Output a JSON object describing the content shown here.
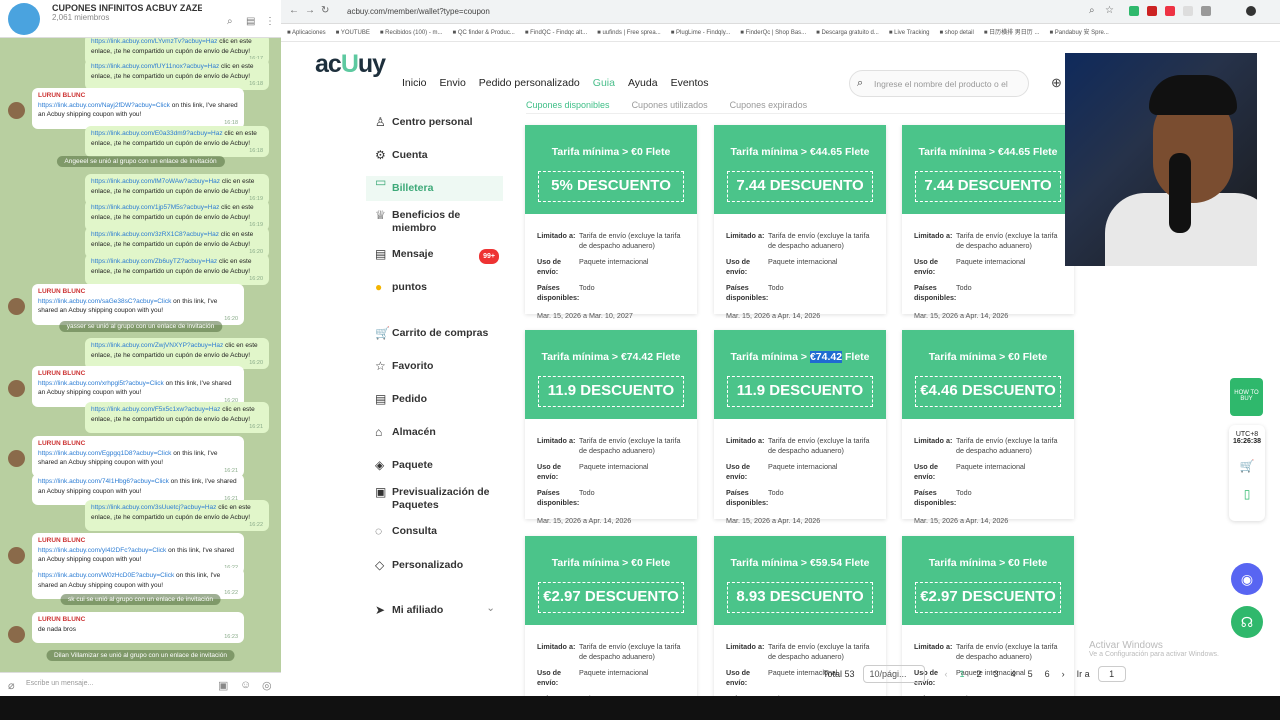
{
  "telegram": {
    "title": "CUPONES INFINITOS ACBUY ZAZERR",
    "members": "2,061 miembros",
    "input_placeholder": "Escribe un mensaje...",
    "messages": [
      {
        "type": "out",
        "link": "https://link.acbuy.com/LYvmzTv?acbuy=Haz",
        "text": " clic en este enlace, ¡te he compartido un cupón de envío de Acbuy!",
        "time": "16:17"
      },
      {
        "type": "out",
        "link": "https://link.acbuy.com/fUY11nox?acbuy=Haz",
        "text": " clic en este enlace, ¡te he compartido un cupón de envío de Acbuy!",
        "time": "16:18"
      },
      {
        "type": "in",
        "who": "LURUN BLUNC",
        "link": "https://link.acbuy.com/Nayj2fDW?acbuy=Click",
        "text": " on this link, I've shared an Acbuy shipping coupon with you!",
        "time": "16:18"
      },
      {
        "type": "out",
        "link": "https://link.acbuy.com/E0a33dm9?acbuy=Haz",
        "text": " clic en este enlace, ¡te he compartido un cupón de envío de Acbuy!",
        "time": "16:18"
      },
      {
        "type": "sys",
        "text": "Angeeel se unió al grupo con un enlace de invitación"
      },
      {
        "type": "out",
        "link": "https://link.acbuy.com/lM7oWAw?acbuy=Haz",
        "text": " clic en este enlace, ¡te he compartido un cupón de envío de Acbuy!",
        "time": "16:19"
      },
      {
        "type": "out",
        "link": "https://link.acbuy.com/1jp57M5s?acbuy=Haz",
        "text": " clic en este enlace, ¡te he compartido un cupón de envío de Acbuy!",
        "time": "16:19"
      },
      {
        "type": "out",
        "link": "https://link.acbuy.com/3zRX1C8?acbuy=Haz",
        "text": " clic en este enlace, ¡te he compartido un cupón de envío de Acbuy!",
        "time": "16:20"
      },
      {
        "type": "out",
        "link": "https://link.acbuy.com/Zb6uyTZ?acbuy=Haz",
        "text": " clic en este enlace, ¡te he compartido un cupón de envío de Acbuy!",
        "time": "16:20"
      },
      {
        "type": "in",
        "who": "LURUN BLUNC",
        "link": "https://link.acbuy.com/saGe38sC?acbuy=Click",
        "text": " on this link, I've shared an Acbuy shipping coupon with you!",
        "time": "16:20"
      },
      {
        "type": "sys",
        "text": "yasser se unió al grupo con un enlace de invitación"
      },
      {
        "type": "out",
        "link": "https://link.acbuy.com/ZwjVNXYP?acbuy=Haz",
        "text": " clic en este enlace, ¡te he compartido un cupón de envío de Acbuy!",
        "time": "16:20"
      },
      {
        "type": "in",
        "who": "LURUN BLUNC",
        "link": "https://link.acbuy.com/xrhpgl5t?acbuy=Click",
        "text": " on this link, I've shared an Acbuy shipping coupon with you!",
        "time": "16:20"
      },
      {
        "type": "out",
        "link": "https://link.acbuy.com/F5x5c1xw?acbuy=Haz",
        "text": " clic en este enlace, ¡te he compartido un cupón de envío de Acbuy!",
        "time": "16:21"
      },
      {
        "type": "in",
        "who": "LURUN BLUNC",
        "link": "https://link.acbuy.com/Egpgq1D8?acbuy=Click",
        "text": " on this link, I've shared an Acbuy shipping coupon with you!",
        "time": "16:21"
      },
      {
        "type": "in2",
        "link": "https://link.acbuy.com/74I1Hbg6?acbuy=Click",
        "text": " on this link, I've shared an Acbuy shipping coupon with you!",
        "time": "16:21"
      },
      {
        "type": "out",
        "link": "https://link.acbuy.com/3sUuetcj?acbuy=Haz",
        "text": " clic en este enlace, ¡te he compartido un cupón de envío de Acbuy!",
        "time": "16:22"
      },
      {
        "type": "in",
        "who": "LURUN BLUNC",
        "link": "https://link.acbuy.com/yI4l2DFc?acbuy=Click",
        "text": " on this link, I've shared an Acbuy shipping coupon with you!",
        "time": "16:22"
      },
      {
        "type": "in2",
        "link": "https://link.acbuy.com/W0zHcD0E?acbuy=Click",
        "text": " on this link, I've shared an Acbuy shipping coupon with you!",
        "time": "16:22"
      },
      {
        "type": "sys",
        "text": "sk cui se unió al grupo con un enlace de invitación"
      },
      {
        "type": "in",
        "who": "LURUN BLUNC",
        "link": "",
        "text": "de nada bros",
        "time": "16:23"
      },
      {
        "type": "sys",
        "text": "Dilan Villamizar se unió al grupo con un enlace de invitación"
      }
    ]
  },
  "browser": {
    "url": "acbuy.com/member/wallet?type=coupon",
    "bookmarks": [
      "Aplicaciones",
      "YOUTUBE",
      "Recibidos (100) - m...",
      "QC finder & Produc...",
      "FindQC - Findqc alt...",
      "uufinds | Free sprea...",
      "PlugLime - Findqly...",
      "FinderQc | Shop Bas...",
      "Descarga gratuito d...",
      "Live Tracking",
      "shop detail",
      "日历横排 男日历 ...",
      "Pandabuy 安 Spre..."
    ]
  },
  "site": {
    "logo_a": "ac",
    "logo_b": "U",
    "logo_c": "uy",
    "menu": [
      "Inicio",
      "Envio",
      "Pedido personalizado",
      "Guia",
      "Ayuda",
      "Eventos"
    ],
    "search_placeholder": "Ingrese el nombre del producto o el",
    "tabs": [
      "Cupones disponibles",
      "Cupones utilizados",
      "Cupones expirados"
    ],
    "sidebar": [
      "Centro personal",
      "Cuenta",
      "Billetera",
      "Beneficios de miembro",
      "Mensaje",
      "puntos",
      "Carrito de compras",
      "Favorito",
      "Pedido",
      "Almacén",
      "Paquete",
      "Previsualización de Paquetes",
      "Consulta",
      "Personalizado",
      "Mi afiliado"
    ],
    "badge": "99+",
    "coupon_labels": {
      "limit": "Limitado a:",
      "limit_val": "Tarifa de envío (excluye la tarifa de despacho aduanero)",
      "use": "Uso de envío:",
      "use_val": "Paquete internacional",
      "countries": "Países disponibles:",
      "countries_val": "Todo"
    },
    "coupons": [
      {
        "tarifa": "Tarifa mínima > €0 Flete",
        "disc": "5% DESCUENTO",
        "date": "Mar. 15, 2026 a Mar. 10, 2027"
      },
      {
        "tarifa": "Tarifa mínima > €44.65 Flete",
        "disc": "7.44 DESCUENTO",
        "date": "Mar. 15, 2026 a Apr. 14, 2026"
      },
      {
        "tarifa": "Tarifa mínima > €44.65 Flete",
        "disc": "7.44 DESCUENTO",
        "date": "Mar. 15, 2026 a Apr. 14, 2026"
      },
      {
        "tarifa": "Tarifa mínima > €74.42 Flete",
        "disc": "11.9 DESCUENTO",
        "date": "Mar. 15, 2026 a Apr. 14, 2026"
      },
      {
        "tarifa": "Tarifa mínima > €74.42 Flete",
        "disc": "11.9 DESCUENTO",
        "date": "Mar. 15, 2026 a Apr. 14, 2026"
      },
      {
        "tarifa": "Tarifa mínima > €0 Flete",
        "disc": "€4.46 DESCUENTO",
        "date": "Mar. 15, 2026 a Apr. 14, 2026"
      },
      {
        "tarifa": "Tarifa mínima > €0 Flete",
        "disc": "€2.97 DESCUENTO",
        "date": ""
      },
      {
        "tarifa": "Tarifa mínima > €59.54 Flete",
        "disc": "8.93 DESCUENTO",
        "date": ""
      },
      {
        "tarifa": "Tarifa mínima > €0 Flete",
        "disc": "€2.97 DESCUENTO",
        "date": ""
      }
    ],
    "pager": {
      "total": "Total 53",
      "per_page": "10/pági...",
      "pages": [
        "1",
        "2",
        "3",
        "4",
        "5",
        "6"
      ],
      "goto": "Ir a",
      "goto_val": "1"
    },
    "side_tools": {
      "howto": "HOW TO BUY",
      "tz": "UTC+8",
      "time": "16:26:38"
    }
  },
  "os": {
    "activate_title": "Activar Windows",
    "activate_sub": "Ve a Configuración para activar Windows."
  },
  "colors": {
    "accent": "#4bc48a",
    "highlight": "#1f6bd1"
  }
}
